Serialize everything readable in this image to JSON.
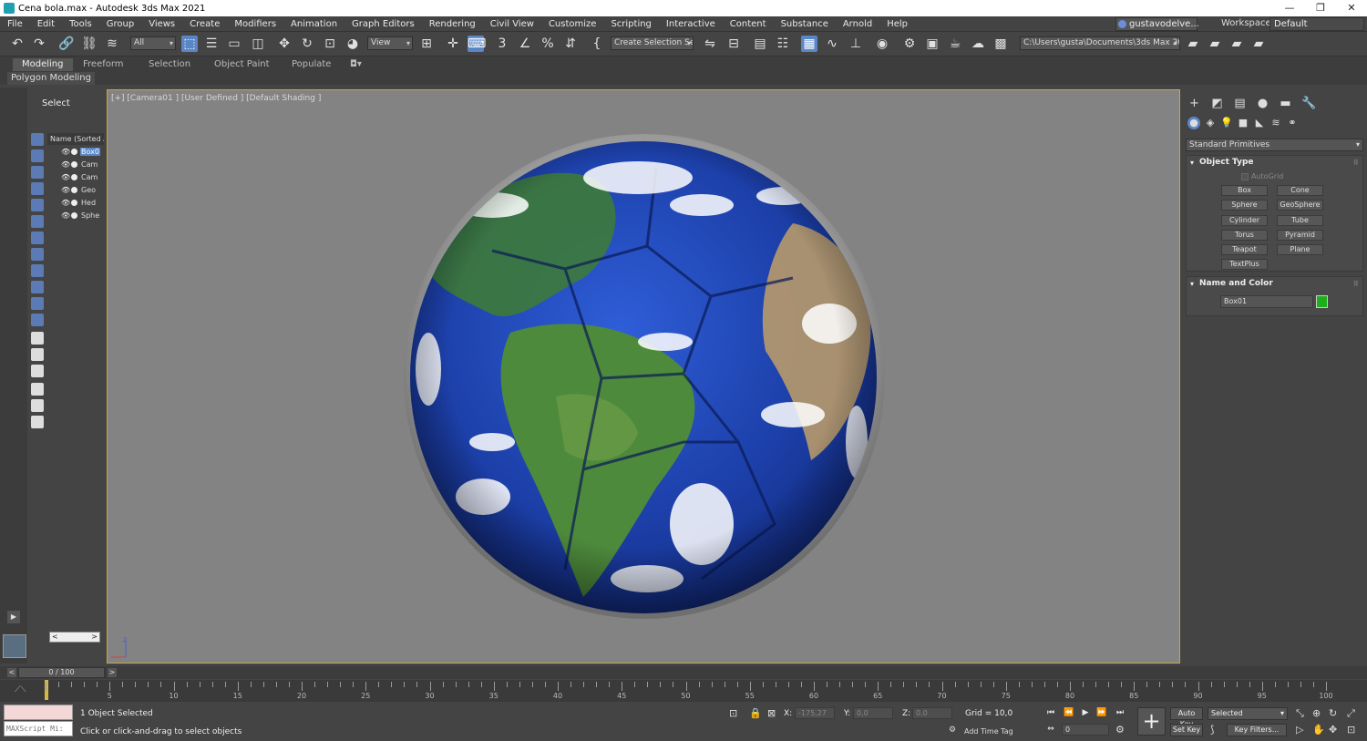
{
  "window": {
    "title": "Cena bola.max - Autodesk 3ds Max 2021",
    "controls": [
      "—",
      "❐",
      "✕"
    ]
  },
  "menu": {
    "items": [
      "File",
      "Edit",
      "Tools",
      "Group",
      "Views",
      "Create",
      "Modifiers",
      "Animation",
      "Graph Editors",
      "Rendering",
      "Civil View",
      "Customize",
      "Scripting",
      "Interactive",
      "Content",
      "Substance",
      "Arnold",
      "Help"
    ],
    "user": "gustavodelve...",
    "workspace_label": "Workspaces:",
    "workspace_value": "Default"
  },
  "toolbar": {
    "selection_filter": "All",
    "ref_coord": "View",
    "named_selection": "Create Selection Se",
    "project_path": "C:\\Users\\gusta\\Documents\\3ds Max 2021"
  },
  "ribbon": {
    "tabs": [
      "Modeling",
      "Freeform",
      "Selection",
      "Object Paint",
      "Populate"
    ],
    "active_tab": "Modeling",
    "panel_label": "Polygon Modeling"
  },
  "scene_explorer": {
    "title": "Select",
    "column_header": "Name (Sorted A",
    "items": [
      "Box0",
      "Cam",
      "Cam",
      "Geo",
      "Hed",
      "Sphe"
    ],
    "selected_index": 0
  },
  "viewport": {
    "label": "[+] [Camera01 ] [User Defined ] [Default Shading ]",
    "axis_z": "z"
  },
  "command_panel": {
    "category": "Standard Primitives",
    "object_type_title": "Object Type",
    "autogrid": "AutoGrid",
    "primitives": [
      "Box",
      "Cone",
      "Sphere",
      "GeoSphere",
      "Cylinder",
      "Tube",
      "Torus",
      "Pyramid",
      "Teapot",
      "Plane",
      "TextPlus"
    ],
    "name_color_title": "Name and Color",
    "object_name": "Box01",
    "object_color": "#1cb01c"
  },
  "timeline": {
    "slider_label": "0 / 100",
    "ticks": [
      5,
      10,
      15,
      20,
      25,
      30,
      35,
      40,
      45,
      50,
      55,
      60,
      65,
      70,
      75,
      80,
      85,
      90,
      95,
      100
    ],
    "current_frame": 0
  },
  "status": {
    "maxscript_placeholder": "MAXScript Mi:",
    "selection_count": "1 Object Selected",
    "prompt": "Click or click-and-drag to select objects",
    "x_label": "X:",
    "x_value": "-175,27",
    "y_label": "Y:",
    "y_value": "0,0",
    "z_label": "Z:",
    "z_value": "0,0",
    "grid": "Grid = 10,0",
    "add_time_tag": "Add Time Tag",
    "frame_value": "0",
    "auto_key": "Auto Key",
    "set_key": "Set Key",
    "key_mode": "Selected",
    "key_filters": "Key Filters..."
  }
}
